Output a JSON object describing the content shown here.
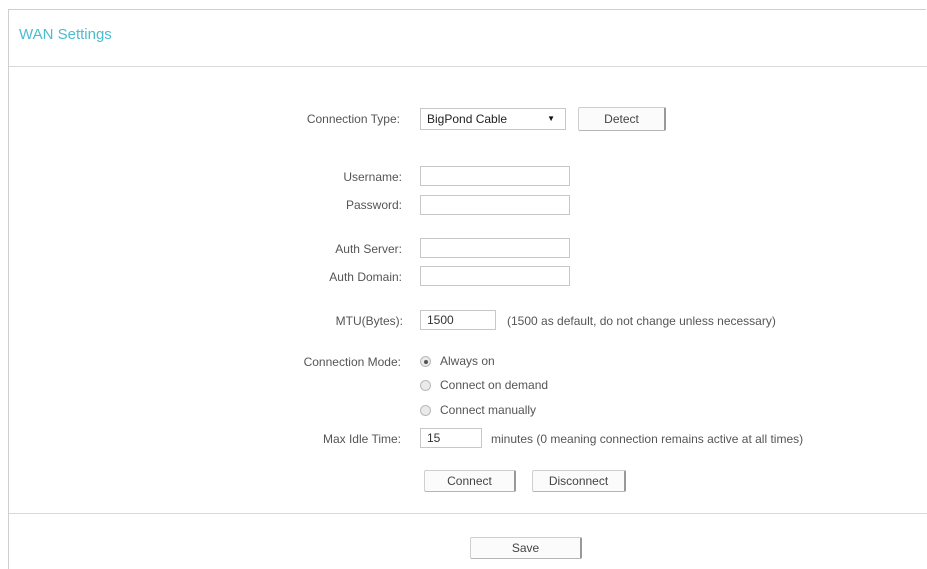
{
  "header": {
    "title": "WAN Settings"
  },
  "connection_type": {
    "label": "Connection Type:",
    "selected": "BigPond Cable",
    "detect_label": "Detect"
  },
  "username": {
    "label": "Username:",
    "value": ""
  },
  "password": {
    "label": "Password:",
    "value": ""
  },
  "auth_server": {
    "label": "Auth Server:",
    "value": ""
  },
  "auth_domain": {
    "label": "Auth Domain:",
    "value": ""
  },
  "mtu": {
    "label": "MTU(Bytes):",
    "value": "1500",
    "note": "(1500 as default, do not change unless necessary)"
  },
  "connection_mode": {
    "label": "Connection Mode:",
    "options": [
      {
        "label": "Always on",
        "checked": true
      },
      {
        "label": "Connect on demand",
        "checked": false
      },
      {
        "label": "Connect manually",
        "checked": false
      }
    ]
  },
  "max_idle": {
    "label": "Max Idle Time:",
    "value": "15",
    "note": "minutes (0 meaning connection remains active at all times)"
  },
  "actions": {
    "connect_label": "Connect",
    "disconnect_label": "Disconnect"
  },
  "footer": {
    "save_label": "Save"
  },
  "colors": {
    "title": "#4bbcd1",
    "border": "#cfcfcf"
  }
}
